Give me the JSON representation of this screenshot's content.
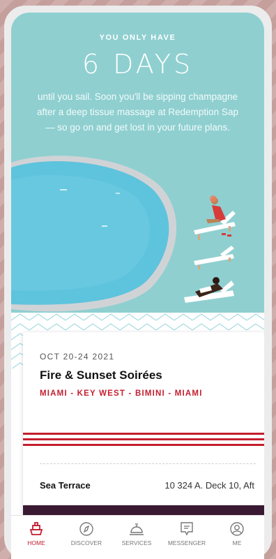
{
  "hero": {
    "eyebrow": "YOU ONLY HAVE",
    "countdown": "6 DAYS",
    "message": "until you sail. Soon you'll be sipping champagne after a deep tissue massage at Redemption Sap — so go on and get lost in your future plans."
  },
  "voyage": {
    "dates": "OCT 20-24 2021",
    "name": "Fire & Sunset Soirées",
    "route": "MIAMI - KEY WEST - BIMINI - MIAMI",
    "cabin_type": "Sea Terrace",
    "cabin_location": "10 324 A. Deck 10, Aft"
  },
  "nav": {
    "items": [
      {
        "label": "HOME",
        "icon": "ship-icon",
        "active": true
      },
      {
        "label": "DISCOVER",
        "icon": "compass-icon",
        "active": false
      },
      {
        "label": "SERVICES",
        "icon": "service-bell-icon",
        "active": false
      },
      {
        "label": "MESSENGER",
        "icon": "message-icon",
        "active": false
      },
      {
        "label": "ME",
        "icon": "user-icon",
        "active": false
      }
    ]
  },
  "colors": {
    "accent": "#c31e2f",
    "hero_bg": "#8fcfd0",
    "pool": "#5ec3dd",
    "dark_panel": "#3a1a33"
  }
}
